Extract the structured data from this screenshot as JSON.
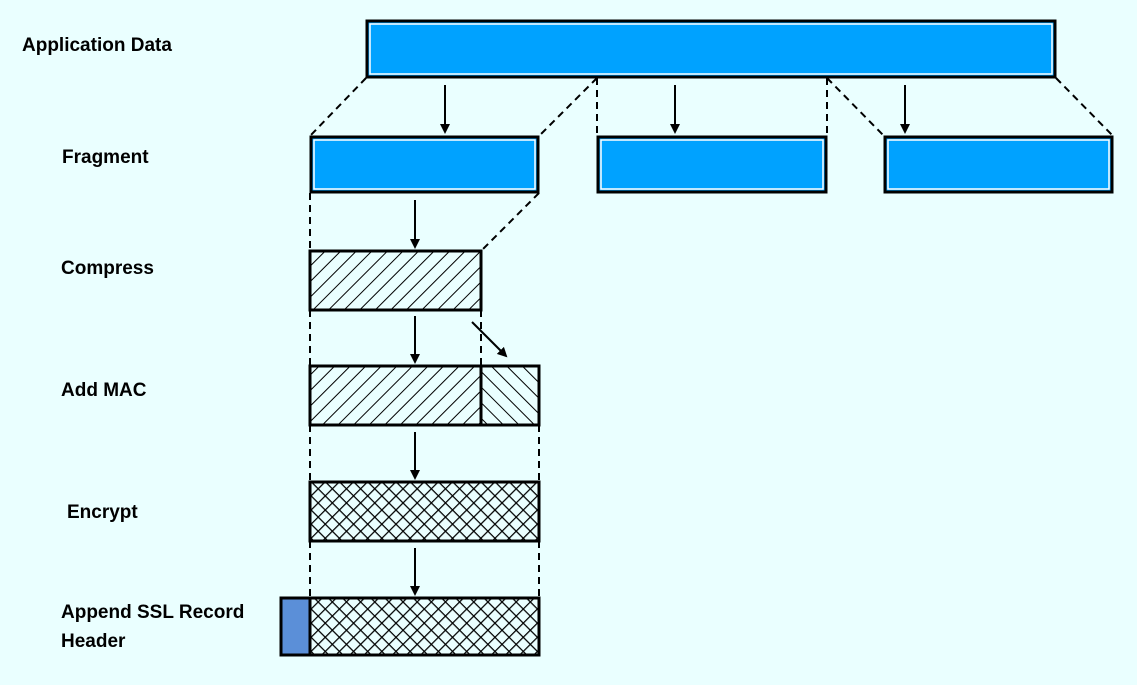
{
  "labels": {
    "application_data": "Application Data",
    "fragment": "Fragment",
    "compress": "Compress",
    "add_mac": "Add MAC",
    "encrypt": "Encrypt",
    "append_line1": "Append SSL Record",
    "append_line2": "Header"
  },
  "colors": {
    "background": "#eaffff",
    "data_block": "#00a2ff",
    "header_block": "#5b8fd8",
    "stroke": "#000000"
  },
  "fragment_count": 3
}
